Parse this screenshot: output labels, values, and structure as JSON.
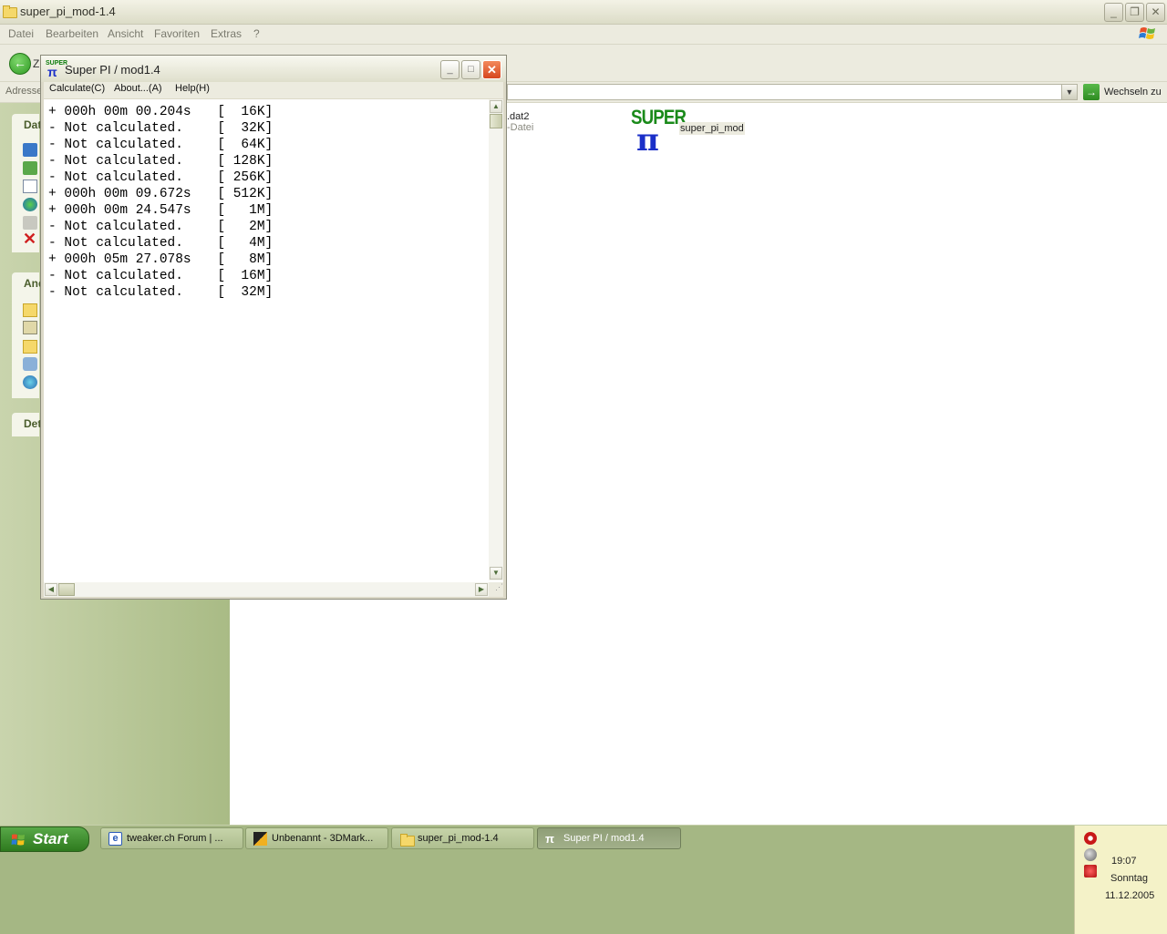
{
  "explorer": {
    "title": "super_pi_mod-1.4",
    "menu": [
      "Datei",
      "Bearbeiten",
      "Ansicht",
      "Favoriten",
      "Extras",
      "?"
    ],
    "back_label": "Z",
    "address_label": "Adresse",
    "go_label": "Wechseln zu",
    "left_pane_headers": [
      "Dat",
      "And",
      "Det"
    ],
    "files": [
      {
        "name": ".dat2",
        "type": "-Datei"
      },
      {
        "name": "super_pi_mod",
        "logo_text": "SUPER",
        "logo_glyph": "π"
      }
    ]
  },
  "superpi": {
    "title": "Super PI / mod1.4",
    "icon_text": "SUPER",
    "menu": [
      "Calculate(C)",
      "About...(A)",
      "Help(H)"
    ],
    "results": [
      {
        "mark": "+",
        "time": "000h 00m 00.204s",
        "size": "16K"
      },
      {
        "mark": "-",
        "time": "Not calculated.",
        "size": "32K"
      },
      {
        "mark": "-",
        "time": "Not calculated.",
        "size": "64K"
      },
      {
        "mark": "-",
        "time": "Not calculated.",
        "size": "128K"
      },
      {
        "mark": "-",
        "time": "Not calculated.",
        "size": "256K"
      },
      {
        "mark": "+",
        "time": "000h 00m 09.672s",
        "size": "512K"
      },
      {
        "mark": "+",
        "time": "000h 00m 24.547s",
        "size": "1M"
      },
      {
        "mark": "-",
        "time": "Not calculated.",
        "size": "2M"
      },
      {
        "mark": "-",
        "time": "Not calculated.",
        "size": "4M"
      },
      {
        "mark": "+",
        "time": "000h 05m 27.078s",
        "size": "8M"
      },
      {
        "mark": "-",
        "time": "Not calculated.",
        "size": "16M"
      },
      {
        "mark": "-",
        "time": "Not calculated.",
        "size": "32M"
      }
    ]
  },
  "taskbar": {
    "start_label": "Start",
    "buttons": [
      {
        "label": "tweaker.ch Forum | ...",
        "icon": "ie-icon",
        "active": false
      },
      {
        "label": "Unbenannt - 3DMark...",
        "icon": "3dmark-icon",
        "active": false
      },
      {
        "label": "super_pi_mod-1.4",
        "icon": "folder-icon",
        "active": false
      },
      {
        "label": "Super PI / mod1.4",
        "icon": "superpi-icon",
        "active": true
      }
    ],
    "clock": {
      "time": "19:07",
      "day": "Sonntag",
      "date": "11.12.2005"
    }
  },
  "colors": {
    "taskbar": "#a5b784",
    "close_button": "#d6461e",
    "logo_green": "#1a8a1a",
    "logo_blue": "#1a2fc8"
  }
}
